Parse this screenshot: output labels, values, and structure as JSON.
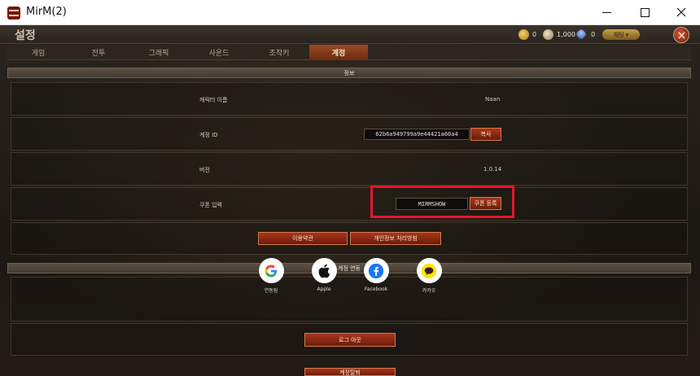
{
  "window": {
    "title": "MirM(2)",
    "minimize_symbol": "—",
    "close_symbol": "✕"
  },
  "topbar": {
    "title": "설정",
    "gold": "0",
    "silver": "1,000",
    "gem": "0",
    "dropdown_label": "채팅 ▾"
  },
  "tabs": [
    {
      "label": "게임",
      "active": false
    },
    {
      "label": "전투",
      "active": false
    },
    {
      "label": "그래픽",
      "active": false
    },
    {
      "label": "사운드",
      "active": false
    },
    {
      "label": "조작키",
      "active": false
    },
    {
      "label": "계정",
      "active": true
    }
  ],
  "info": {
    "section_title": "정보",
    "character_name_label": "캐릭터 이름",
    "character_name_value": "Naan",
    "account_id_label": "계정 ID",
    "account_id_value": "62b6a949799a9e44421a60a4",
    "copy_button": "복사",
    "version_label": "버전",
    "version_value": "1.0.14",
    "coupon_label": "쿠폰 입력",
    "coupon_value": "MIRMSHOW",
    "coupon_button": "쿠폰 등록",
    "terms_button": "이용약관",
    "privacy_button": "개인정보 처리방침"
  },
  "linking": {
    "section_title": "계정 연동",
    "providers": [
      {
        "name": "google",
        "label": "연동됨",
        "icon": "google-icon"
      },
      {
        "name": "apple",
        "label": "Apple",
        "icon": "apple-icon"
      },
      {
        "name": "facebook",
        "label": "Facebook",
        "icon": "facebook-icon"
      },
      {
        "name": "kakao",
        "label": "카카오",
        "icon": "kakao-icon"
      }
    ],
    "logout_button": "로그 아웃",
    "bottom_button_partial": "계정탈퇴"
  },
  "colors": {
    "highlight_border": "#e4162b",
    "active_tab": "#9c4a23",
    "button_red": "#a8361c"
  }
}
